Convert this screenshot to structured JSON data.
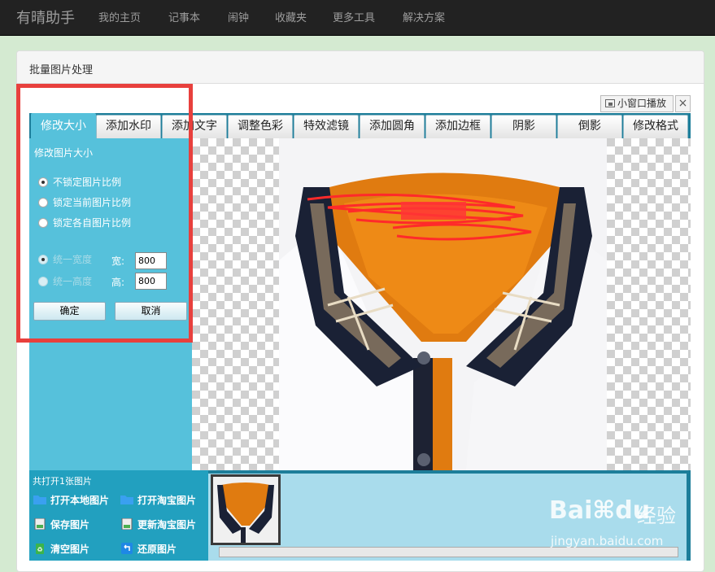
{
  "navbar": {
    "brand": "有晴助手",
    "items": [
      "我的主页",
      "记事本",
      "闹钟",
      "收藏夹",
      "更多工具",
      "解决方案"
    ]
  },
  "card": {
    "title": "批量图片处理"
  },
  "window": {
    "mini_label": "小窗口播放",
    "close_label": "×"
  },
  "tabs": [
    "修改大小",
    "添加水印",
    "添加文字",
    "调整色彩",
    "特效滤镜",
    "添加圆角",
    "添加边框",
    "阴影",
    "倒影",
    "修改格式"
  ],
  "active_tab": "修改大小",
  "resize_panel": {
    "title": "修改图片大小",
    "ratio_options": [
      {
        "label": "不锁定图片比例",
        "checked": true
      },
      {
        "label": "锁定当前图片比例",
        "checked": false
      },
      {
        "label": "锁定各自图片比例",
        "checked": false
      }
    ],
    "unify_options": [
      {
        "label": "统一宽度",
        "disabled": true,
        "checked": true
      },
      {
        "label": "统一高度",
        "disabled": true,
        "checked": false
      }
    ],
    "width_label": "宽:",
    "width_value": "800",
    "height_label": "高:",
    "height_value": "800",
    "confirm_label": "确定",
    "cancel_label": "取消"
  },
  "file_panel": {
    "count_text": "共打开1张图片",
    "actions": {
      "open_local": "打开本地图片",
      "open_taobao": "打开淘宝图片",
      "save": "保存图片",
      "update_taobao": "更新淘宝图片",
      "clear": "清空图片",
      "restore": "还原图片"
    }
  },
  "watermark": {
    "brand": "Bai",
    "brand_end": "du",
    "text": "经验",
    "url": "jingyan.baidu.com"
  },
  "colors": {
    "accent": "#56c1db",
    "dark_teal": "#1d7e9a",
    "highlight": "#e8403d",
    "navbar": "#222222"
  }
}
